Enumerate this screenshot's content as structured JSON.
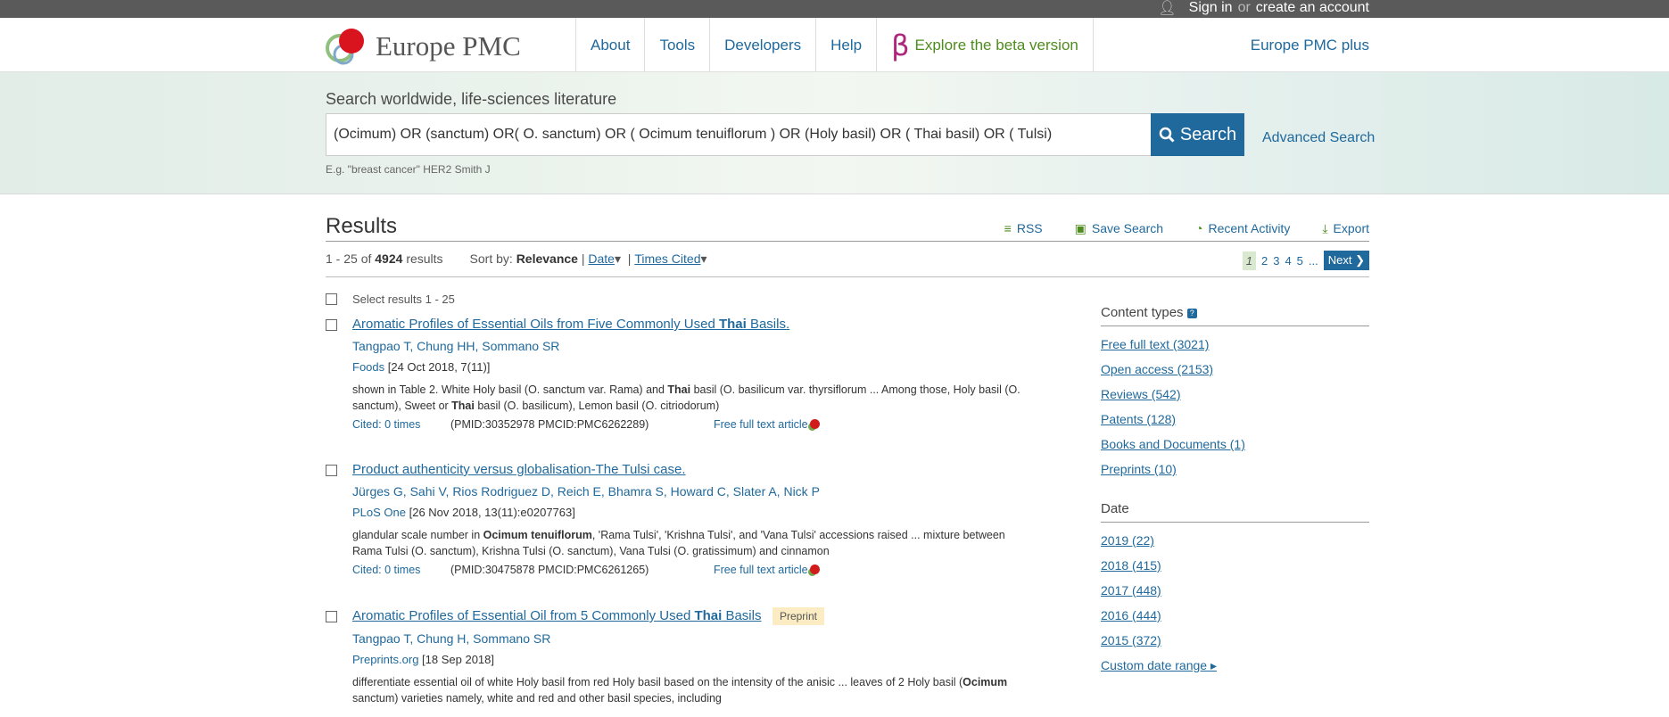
{
  "topbar": {
    "sign_in": "Sign in",
    "or": "or",
    "create_account": "create an account"
  },
  "header": {
    "brand": "Europe PMC",
    "nav": [
      "About",
      "Tools",
      "Developers",
      "Help"
    ],
    "beta_symbol": "β",
    "beta_label": "Explore the beta version",
    "plus": "Europe PMC plus"
  },
  "search": {
    "label": "Search worldwide, life-sciences literature",
    "query": "(Ocimum) OR (sanctum) OR( O. sanctum) OR ( Ocimum tenuiflorum ) OR (Holy basil) OR ( Thai basil) OR ( Tulsi)",
    "button": "Search",
    "advanced": "Advanced Search",
    "example": "E.g. \"breast cancer\" HER2 Smith J"
  },
  "results": {
    "heading": "Results",
    "tools": [
      "RSS",
      "Save Search",
      "Recent Activity",
      "Export"
    ],
    "range": "1 - 25 of",
    "total": "4924",
    "results_word": "results",
    "sort_label": "Sort by:",
    "sort_current": "Relevance",
    "sort_options": [
      "Date",
      "Times Cited"
    ],
    "pages": [
      "1",
      "2",
      "3",
      "4",
      "5",
      "..."
    ],
    "next": "Next",
    "select_label": "Select results 1 - 25",
    "items": [
      {
        "title_pre": "Aromatic Profiles of Essential Oils from Five Commonly Used ",
        "title_bold": "Thai",
        "title_post": " Basils.",
        "authors": "Tangpao T, Chung HH, Sommano SR",
        "journal": "Foods",
        "details": " [24 Oct 2018, 7(11)]",
        "snippet_a": "shown in Table 2. White Holy basil (O. sanctum var. Rama) and ",
        "snippet_b": "Thai",
        "snippet_c": " basil (O. basilicum var. thyrsiflorum ... Among those, Holy basil (O. sanctum), Sweet or ",
        "snippet_d": "Thai",
        "snippet_e": " basil (O. basilicum), Lemon basil (O. citriodorum)",
        "cited": "Cited: 0 times",
        "ids": "(PMID:30352978 PMCID:PMC6262289)",
        "free": "Free full text article"
      },
      {
        "title": "Product authenticity versus globalisation-The Tulsi case.",
        "authors": "Jürges G, Sahi V, Rios Rodriguez D, Reich E, Bhamra S, Howard C, Slater A, Nick P",
        "journal": "PLoS One",
        "details": " [26 Nov 2018, 13(11):e0207763]",
        "snippet_a": "glandular scale number in ",
        "snippet_b": "Ocimum tenuiflorum",
        "snippet_c": ", 'Rama Tulsi', 'Krishna Tulsi', and 'Vana Tulsi' accessions raised ... mixture between Rama Tulsi (O. sanctum), Krishna Tulsi (O. sanctum), Vana Tulsi (O. gratissimum) and cinnamon",
        "cited": "Cited: 0 times",
        "ids": "(PMID:30475878 PMCID:PMC6261265)",
        "free": "Free full text article"
      },
      {
        "title_pre": "Aromatic Profiles of Essential Oil from 5 Commonly Used ",
        "title_bold": "Thai",
        "title_post": " Basils",
        "badge": "Preprint",
        "authors": "Tangpao T, Chung H, Sommano SR",
        "journal": "Preprints.org",
        "details": " [18 Sep 2018]",
        "snippet_a": "differentiate essential oil of white Holy basil from red Holy basil based on the intensity of the anisic ... leaves of 2 Holy basil (",
        "snippet_b": "Ocimum",
        "snippet_c": " sanctum) varieties namely, white and red and other basil species, including"
      }
    ]
  },
  "sidebar": {
    "content_types_heading": "Content types",
    "help_icon": "?",
    "content_types": [
      "Free full text (3021)",
      "Open access (2153)",
      "Reviews (542)",
      "Patents (128)",
      "Books and Documents (1)",
      "Preprints (10)"
    ],
    "date_heading": "Date",
    "dates": [
      "2019 (22)",
      "2018 (415)",
      "2017 (448)",
      "2016 (444)",
      "2015 (372)"
    ],
    "custom_range": "Custom date range"
  },
  "colors": {
    "link": "#20699c",
    "green": "#4f8c1f",
    "beta": "#b0267a",
    "topbar": "#5a5a5a"
  }
}
